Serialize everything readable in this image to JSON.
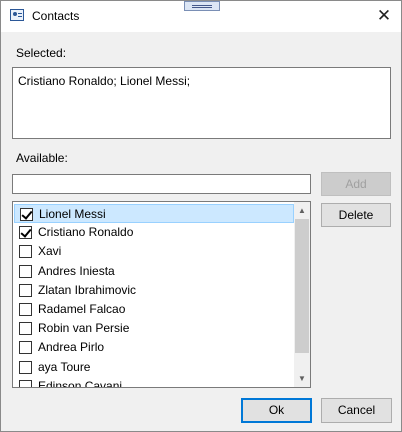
{
  "window": {
    "title": "Contacts",
    "close_glyph": "✕"
  },
  "selected": {
    "label": "Selected:",
    "value": "Cristiano Ronaldo; Lionel Messi;"
  },
  "available": {
    "label": "Available:",
    "search_value": "",
    "search_placeholder": ""
  },
  "buttons": {
    "add": "Add",
    "delete": "Delete",
    "ok": "Ok",
    "cancel": "Cancel"
  },
  "contacts": [
    {
      "name": "Lionel Messi",
      "checked": true,
      "focused": true
    },
    {
      "name": "Cristiano Ronaldo",
      "checked": true,
      "focused": false
    },
    {
      "name": "Xavi",
      "checked": false,
      "focused": false
    },
    {
      "name": "Andres Iniesta",
      "checked": false,
      "focused": false
    },
    {
      "name": "Zlatan Ibrahimovic",
      "checked": false,
      "focused": false
    },
    {
      "name": "Radamel Falcao",
      "checked": false,
      "focused": false
    },
    {
      "name": "Robin van Persie",
      "checked": false,
      "focused": false
    },
    {
      "name": "Andrea Pirlo",
      "checked": false,
      "focused": false
    },
    {
      "name": "aya Toure",
      "checked": false,
      "focused": false
    },
    {
      "name": "Edinson Cavani",
      "checked": false,
      "focused": false
    }
  ],
  "scrollbar": {
    "up_glyph": "▲",
    "down_glyph": "▼"
  },
  "icons": {
    "app": "contacts-card-icon",
    "close": "close-icon",
    "drag": "drag-handle-icon"
  }
}
